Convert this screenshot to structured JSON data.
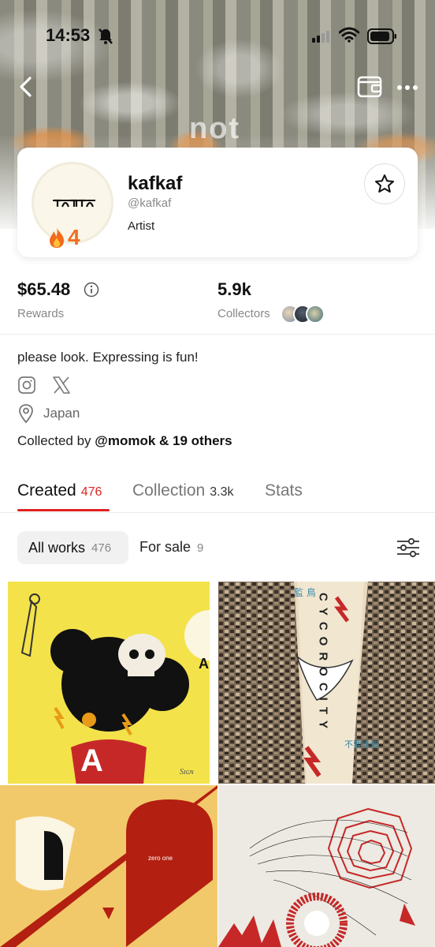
{
  "status": {
    "time": "14:53"
  },
  "cover": {
    "text": "not"
  },
  "profile": {
    "name": "kafkaf",
    "handle": "@kafkaf",
    "role": "Artist",
    "streak": "4",
    "avatar_text": "ᥒ𝖺ᴋᥒ𝖺ᴋ"
  },
  "stats": {
    "rewards_value": "$65.48",
    "rewards_label": "Rewards",
    "collectors_value": "5.9k",
    "collectors_label": "Collectors"
  },
  "bio": {
    "text": "please look. Expressing is fun!",
    "location": "Japan",
    "collected_prefix": "Collected by ",
    "collected_names": "@momok & 19 others"
  },
  "tabs": [
    {
      "label": "Created",
      "count": "476"
    },
    {
      "label": "Collection",
      "count": "3.3k"
    },
    {
      "label": "Stats",
      "count": ""
    }
  ],
  "filters": {
    "all_label": "All works",
    "all_count": "476",
    "sale_label": "For sale",
    "sale_count": "9"
  },
  "artworks": {
    "a1_signature": "Sɪɢɴ",
    "a1_letter": "A",
    "a2_vertical": "CYCOROCITY",
    "a2_kanji_top": "監 鳥",
    "a2_kanji_side": "不要後悔",
    "a3_text": "zero one"
  },
  "colors": {
    "accent": "#e02222",
    "fire": "#f07023"
  }
}
